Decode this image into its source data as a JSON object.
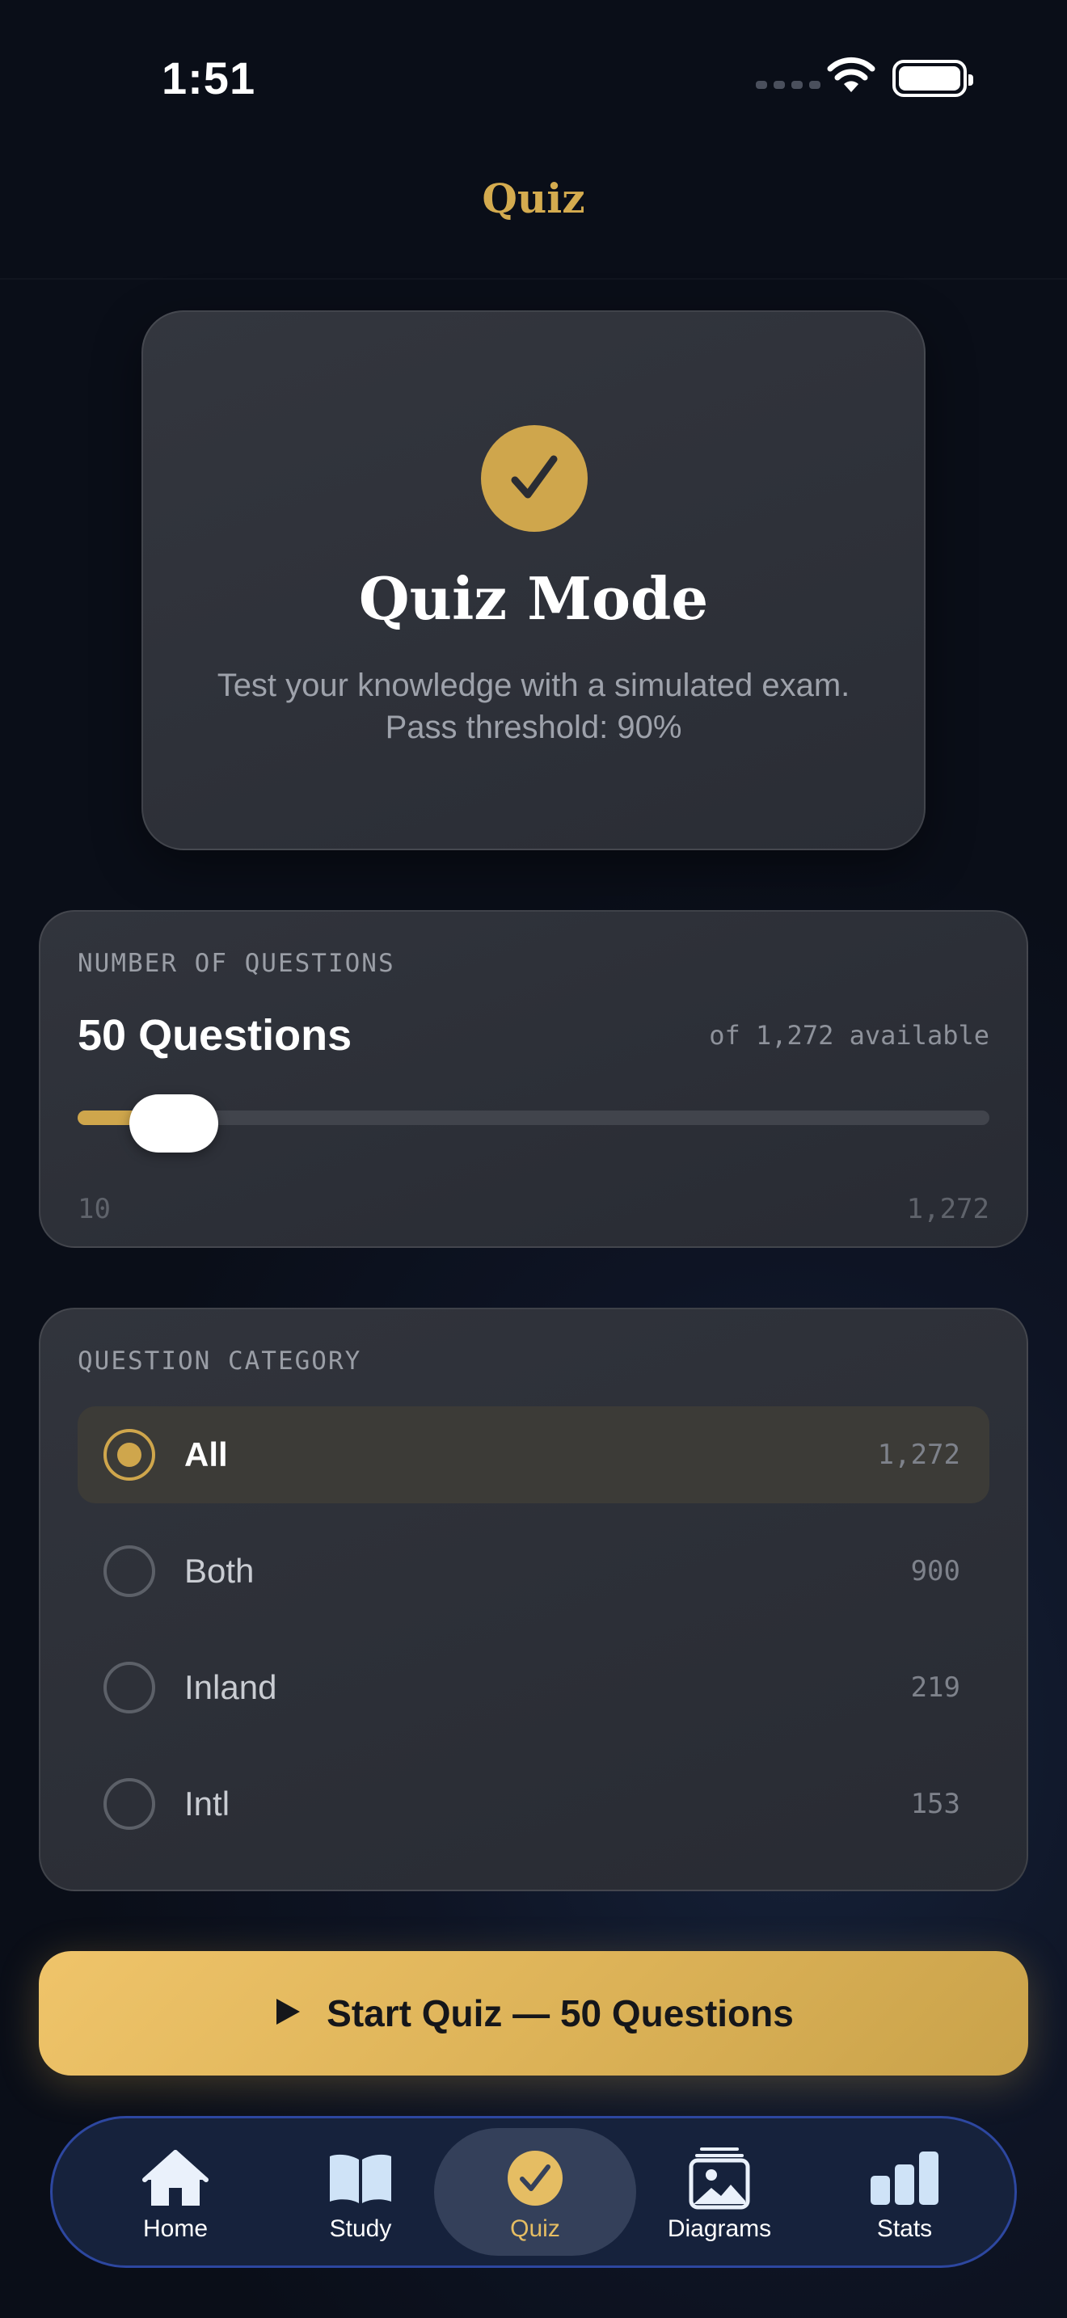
{
  "status_bar": {
    "time": "1:51"
  },
  "nav": {
    "title": "Quiz"
  },
  "hero": {
    "title": "Quiz Mode",
    "description_line1": "Test your knowledge with a simulated exam.",
    "description_line2": "Pass threshold: 90%",
    "icon": "checkmark-icon"
  },
  "question_count": {
    "section_label": "NUMBER OF QUESTIONS",
    "value_label": "50 Questions",
    "available_label": "of 1,272 available",
    "min_label": "10",
    "max_label": "1,272",
    "value": 50,
    "min": 10,
    "max": 1272
  },
  "category": {
    "section_label": "QUESTION CATEGORY",
    "options": [
      {
        "label": "All",
        "count": "1,272",
        "selected": true
      },
      {
        "label": "Both",
        "count": "900",
        "selected": false
      },
      {
        "label": "Inland",
        "count": "219",
        "selected": false
      },
      {
        "label": "Intl",
        "count": "153",
        "selected": false
      }
    ]
  },
  "start_button": {
    "label": "Start Quiz — 50 Questions",
    "icon": "play-icon"
  },
  "tab_bar": {
    "tabs": [
      {
        "label": "Home",
        "icon": "house-icon",
        "active": false
      },
      {
        "label": "Study",
        "icon": "book-icon",
        "active": false
      },
      {
        "label": "Quiz",
        "icon": "checkmark-circle-icon",
        "active": true
      },
      {
        "label": "Diagrams",
        "icon": "photo-stack-icon",
        "active": false
      },
      {
        "label": "Stats",
        "icon": "bar-chart-icon",
        "active": false
      }
    ]
  },
  "colors": {
    "accent": "#cfa64c",
    "title_gold": "#d4ab4f",
    "active_tab_label": "#e5bd63",
    "tab_bar_border": "#2d47a0"
  }
}
